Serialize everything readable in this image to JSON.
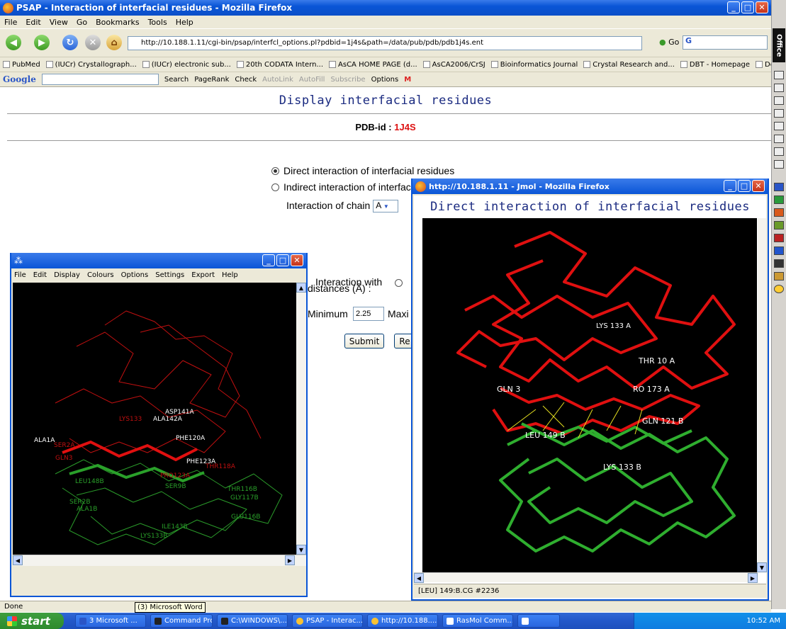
{
  "browser": {
    "title": "PSAP - Interaction of interfacial residues - Mozilla Firefox",
    "menu": [
      "File",
      "Edit",
      "View",
      "Go",
      "Bookmarks",
      "Tools",
      "Help"
    ],
    "url": "http://10.188.1.11/cgi-bin/psap/interfcl_options.pl?pdbid=1j4s&path=/data/pub/pdb/pdb1j4s.ent",
    "go_label": "Go",
    "bookmarks": [
      "PubMed",
      "(IUCr) Crystallograph...",
      "(IUCr) electronic sub...",
      "20th CODATA Intern...",
      "AsCA HOME PAGE (d...",
      "AsCA2006/CrSJ",
      "Bioinformatics Journal",
      "Crystal Research and...",
      "DBT - Homepage",
      "Depth Program"
    ],
    "google_toolbar": {
      "logo": "Google",
      "search": "Search",
      "pagerank": "PageRank",
      "check": "Check",
      "autolink": "AutoLink",
      "autofill": "AutoFill",
      "subscribe": "Subscribe",
      "options": "Options"
    },
    "status": "Done",
    "tooltip": "(3) Microsoft Word"
  },
  "page": {
    "heading": "Display interfacial residues",
    "pdb_label": "PDB-id :",
    "pdb_id": "1J4S",
    "radio_direct": "Direct interaction of interfacial residues",
    "radio_indirect": "Indirect interaction of interfacial residues",
    "chain_label": "Interaction of chain",
    "chain_value": "A",
    "interaction_with_label": "Interaction with",
    "distances_label": "distances (Å) :",
    "minimum_label": "Minimum",
    "minimum_value": "2.25",
    "maximum_label": "Maxi",
    "submit_label": "Submit",
    "reset_label": "Re"
  },
  "jmol": {
    "title": "http://10.188.1.11 - Jmol - Mozilla Firefox",
    "heading": "Direct interaction of interfacial residues",
    "status": "[LEU] 149:B.CG #2236",
    "labels": {
      "lys133a": "LYS 133 A",
      "gln3": "GLN 3",
      "thr": "THR 10 A",
      "pro": "RO 173 A",
      "leu149": "LEU 149 B",
      "gln121": "GLN 121 B",
      "lys133b": "LYS 133 B"
    }
  },
  "rasmol": {
    "menu": [
      "File",
      "Edit",
      "Display",
      "Colours",
      "Options",
      "Settings",
      "Export",
      "Help"
    ],
    "labels": {
      "asp141a": "ASP141A",
      "ala142a": "ALA142A",
      "lys133": "LYS133",
      "ala1a": "ALA1A",
      "ser2a": "SER2A",
      "phe120a": "PHE120A",
      "phe123a": "PHE123A",
      "thr118a": "THR118A",
      "gln3": "GLN3",
      "pro123a": "PRO123A",
      "thr116b": "THR116B",
      "gly117b": "GLY117B",
      "leu": "LEU148B",
      "ser2b": "SER2B",
      "ala1b": "ALA1B",
      "glu116b": "GLU116B",
      "ile143b": "ILE143B",
      "lys133b": "LYS133B",
      "ser9b": "SER9B"
    }
  },
  "taskbar": {
    "start": "start",
    "tasks": [
      "3 Microsoft ...",
      "Command Pro...",
      "C:\\WINDOWS\\...",
      "PSAP - Interac...",
      "http://10.188....",
      "RasMol Comm..."
    ],
    "clock": "10:52 AM"
  },
  "colors": {
    "xp_blue": "#0a55d6",
    "red_chain": "#ee1111",
    "green_chain": "#22aa33",
    "pdb_red": "#dd1111"
  }
}
